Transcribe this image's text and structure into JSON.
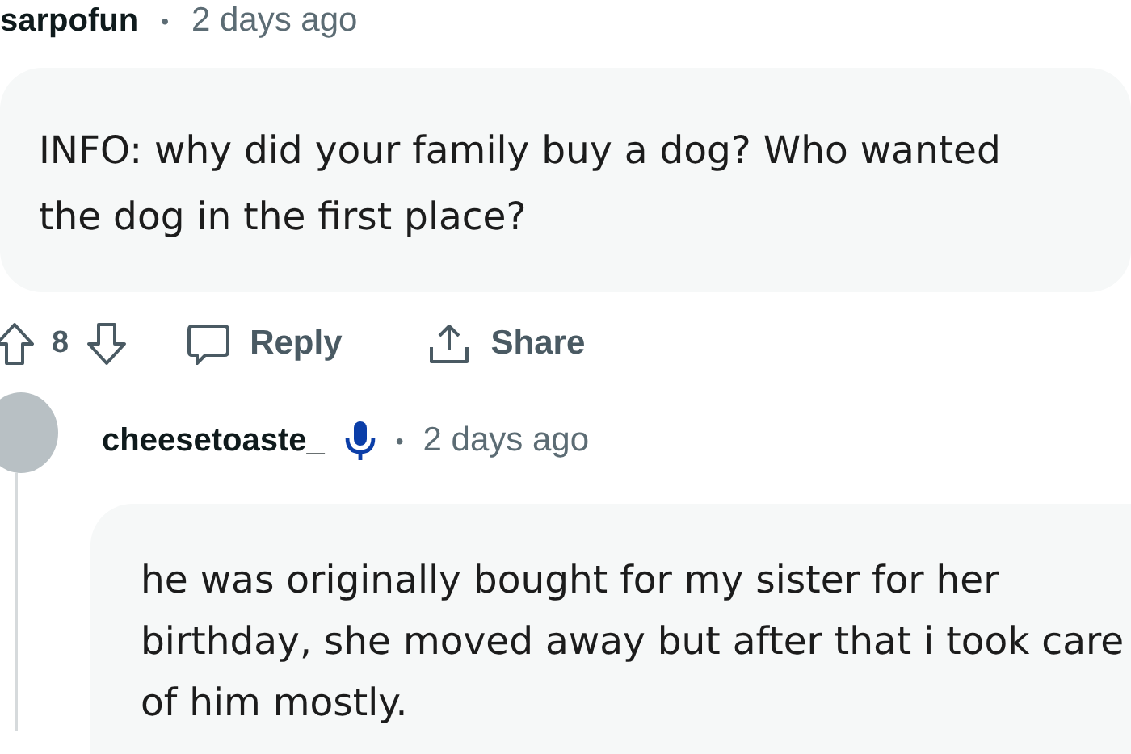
{
  "comments": [
    {
      "author": "sarpofun",
      "separator": "•",
      "time": "2 days ago",
      "body": "INFO: why did your family buy a dog? Who wanted the dog in the first place?",
      "votes": "8",
      "actions": [
        {
          "kind": "reply",
          "label": "Reply"
        },
        {
          "kind": "share",
          "label": "Share"
        }
      ]
    },
    {
      "author": "cheesetoaste_",
      "voice_badge": true,
      "separator": "•",
      "time": "2 days ago",
      "body": "he was originally bought for my sister for her birthday, she moved away but after that i took care of him mostly."
    }
  ]
}
